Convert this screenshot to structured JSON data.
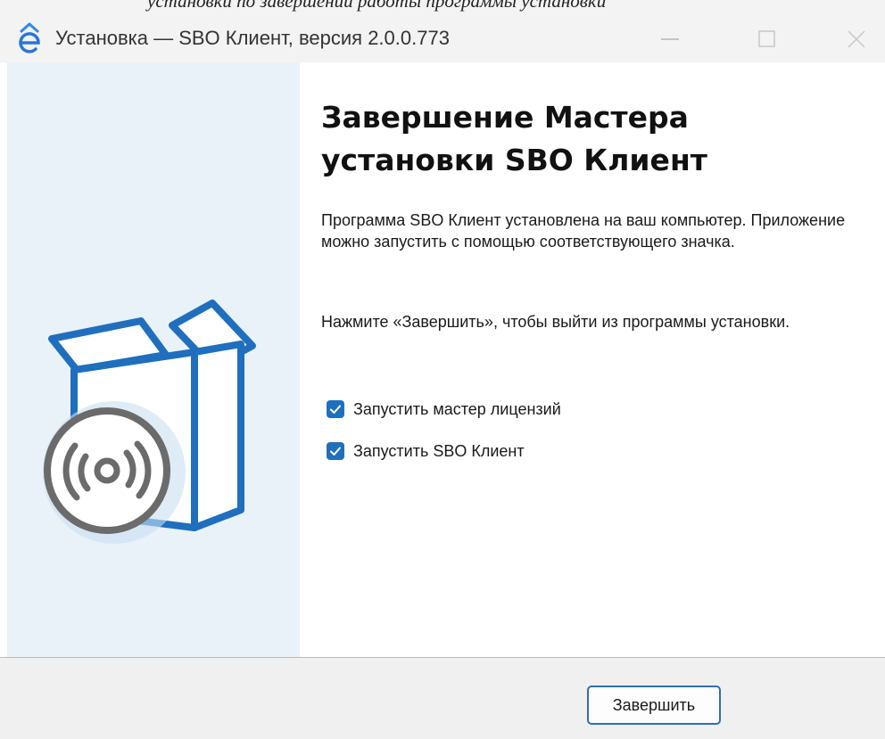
{
  "top_strip": {
    "text": "установки по завершении работы программы установки"
  },
  "window": {
    "title": "Установка — SBO Клиент, версия 2.0.0.773",
    "icon": "sbo-logo-icon",
    "controls": [
      "minimize-icon",
      "maximize-icon",
      "close-icon"
    ]
  },
  "side_panel": {
    "illustration": "box-with-disc-icon",
    "background": "#e9f1f9",
    "accent": "#1f6fbe"
  },
  "page": {
    "heading": "Завершение Мастера установки SBO Клиент",
    "paragraph1": "Программа SBO Клиент установлена на ваш компьютер. Приложение можно запустить с помощью соответствующего значка.",
    "paragraph2": "Нажмите «Завершить», чтобы выйти из программы установки.",
    "options": [
      {
        "label": "Запустить мастер лицензий",
        "checked": true
      },
      {
        "label": "Запустить SBO Клиент",
        "checked": true
      }
    ]
  },
  "footer": {
    "finish_label": "Завершить"
  }
}
